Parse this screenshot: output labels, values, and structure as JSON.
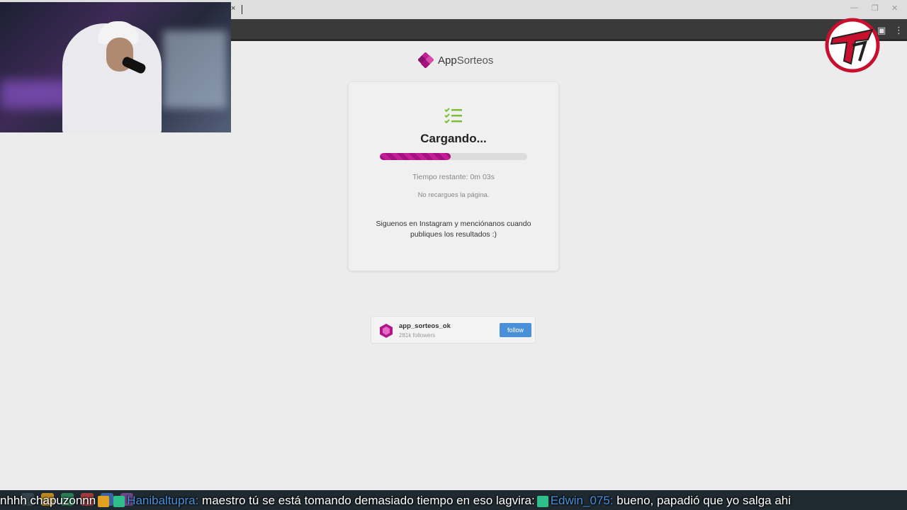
{
  "browser": {
    "tab_close": "×",
    "window_min": "—",
    "window_max": "❐",
    "window_close": "✕",
    "ext_icon": "▣",
    "menu_icon": "⋮"
  },
  "brand": {
    "name": "App",
    "name_bold": "Sorteos",
    "accent": "#b0168a",
    "check_color": "#7bbf3a"
  },
  "card": {
    "title": "Cargando...",
    "progress": 0.48,
    "time_remaining": "Tiempo restante: 0m 03s",
    "warning": "No recargues la página.",
    "follow_text": "Siguenos en Instagram y menciónanos cuando publiques los resultados :)"
  },
  "instagram": {
    "username": "app_sorteos_ok",
    "followers": "281k followers",
    "button_label": "follow",
    "button_color": "#4a90d9"
  },
  "chat": {
    "line_prefix": "nhhh ",
    "user1": "chapuzonnn",
    "user2": "Hanibaltupra:",
    "message2": " maestro tú se está tomando demasiado tiempo en eso ",
    "user3_prefix": "lagvira:",
    "user3": "Edwin_075:",
    "message3": " bueno, papadió que yo salga ahi"
  }
}
